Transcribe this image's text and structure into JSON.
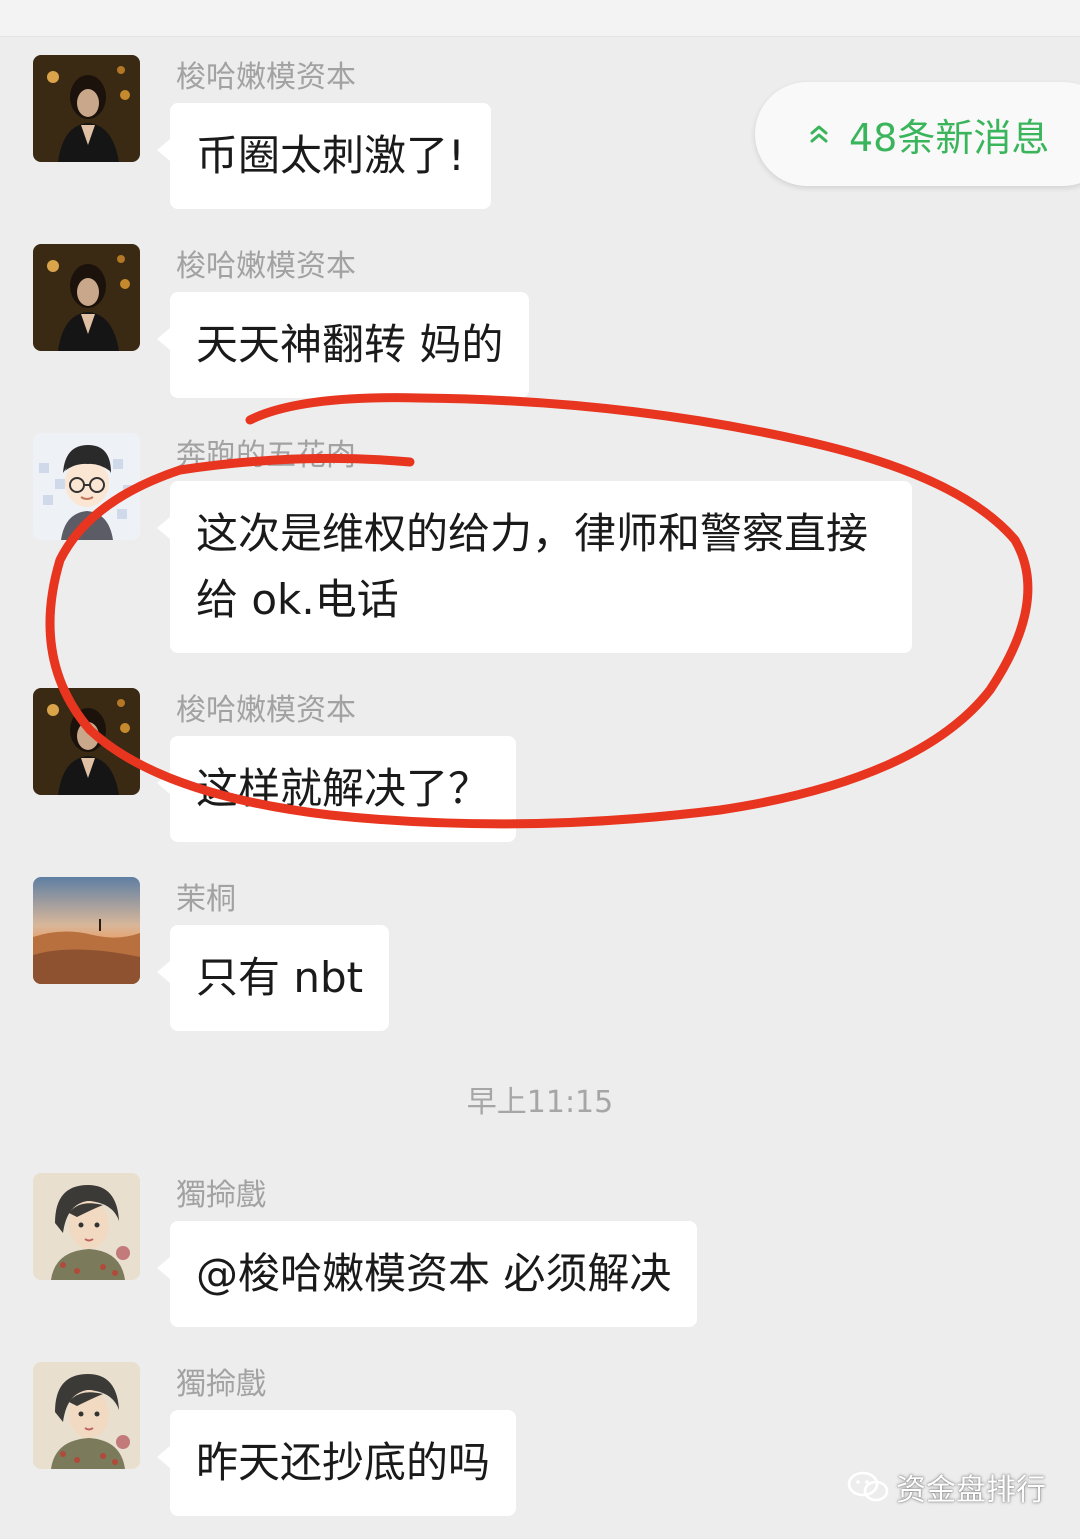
{
  "new_messages_badge": {
    "label": "48条新消息",
    "color": "#3bb55c",
    "icon": "double-chevron-up-icon"
  },
  "messages": [
    {
      "sender": "梭哈嫩模资本",
      "text": "币圈太刺激了!"
    },
    {
      "sender": "梭哈嫩模资本",
      "text": "天天神翻转 妈的"
    },
    {
      "sender": "奔跑的五花肉",
      "text": "这次是维权的给力，律师和警察直接给 ok.电话"
    },
    {
      "sender": "梭哈嫩模资本",
      "text": "这样就解决了？"
    },
    {
      "sender": "茉桐",
      "text": "只有 nbt"
    },
    {
      "sender": "獨掵戲",
      "text": "@梭哈嫩模资本  必须解决"
    },
    {
      "sender": "獨掵戲",
      "text": "昨天还抄底的吗"
    }
  ],
  "timestamp": "早上11:15",
  "watermark": {
    "text": "资金盘排行",
    "icon": "wechat-official-account-icon"
  },
  "annotation_color": "#e8351f"
}
